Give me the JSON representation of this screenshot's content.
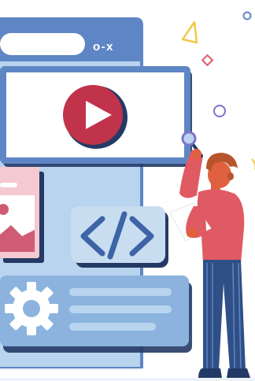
{
  "window": {
    "controls_text": "o-x"
  },
  "icons": {
    "play": "play-icon",
    "code": "code-brackets-icon",
    "gear": "gear-icon",
    "image": "image-icon",
    "magnifier": "magnifier-icon"
  },
  "colors": {
    "background": "#ffffff",
    "window_blue": "#5f86c4",
    "window_light": "#b9d4ef",
    "video_red": "#c0334b",
    "outline_dark": "#243a66",
    "code_blue": "#3d64a6",
    "gear_panel": "#8bb3de",
    "image_card": "#f4c9cf",
    "shirt": "#e05a63",
    "pants": "#2f4f86",
    "hair": "#b8542b",
    "skin": "#e0613f",
    "accent_yellow": "#f0c94b",
    "accent_purple": "#7b74c9"
  }
}
